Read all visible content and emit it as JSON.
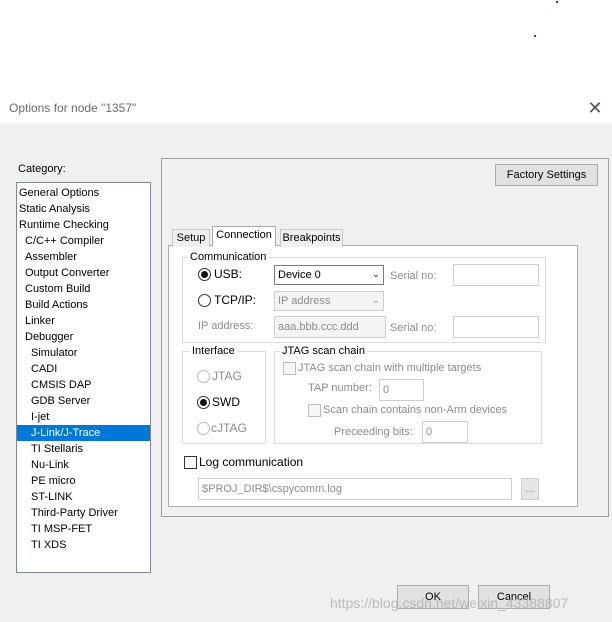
{
  "dialog": {
    "title": "Options for node \"1357\"",
    "close_glyph": "✕"
  },
  "category": {
    "label": "Category:",
    "items": [
      {
        "label": "General Options",
        "indent": 0
      },
      {
        "label": "Static Analysis",
        "indent": 0
      },
      {
        "label": "Runtime Checking",
        "indent": 0
      },
      {
        "label": "C/C++ Compiler",
        "indent": 1
      },
      {
        "label": "Assembler",
        "indent": 1
      },
      {
        "label": "Output Converter",
        "indent": 1
      },
      {
        "label": "Custom Build",
        "indent": 1
      },
      {
        "label": "Build Actions",
        "indent": 1
      },
      {
        "label": "Linker",
        "indent": 1
      },
      {
        "label": "Debugger",
        "indent": 1
      },
      {
        "label": "Simulator",
        "indent": 2
      },
      {
        "label": "CADI",
        "indent": 2
      },
      {
        "label": "CMSIS DAP",
        "indent": 2
      },
      {
        "label": "GDB Server",
        "indent": 2
      },
      {
        "label": "I-jet",
        "indent": 2
      },
      {
        "label": "J-Link/J-Trace",
        "indent": 2,
        "selected": true
      },
      {
        "label": "TI Stellaris",
        "indent": 2
      },
      {
        "label": "Nu-Link",
        "indent": 2
      },
      {
        "label": "PE micro",
        "indent": 2
      },
      {
        "label": "ST-LINK",
        "indent": 2
      },
      {
        "label": "Third-Party Driver",
        "indent": 2
      },
      {
        "label": "TI MSP-FET",
        "indent": 2
      },
      {
        "label": "TI XDS",
        "indent": 2
      }
    ]
  },
  "factory_settings": "Factory Settings",
  "tabs": [
    {
      "label": "Setup",
      "active": false
    },
    {
      "label": "Connection",
      "active": true
    },
    {
      "label": "Breakpoints",
      "active": false
    }
  ],
  "communication": {
    "title": "Communication",
    "usb_label": "USB:",
    "usb_selected": true,
    "usb_device": "Device 0",
    "serial_label": "Serial no:",
    "serial_value": "",
    "tcpip_label": "TCP/IP:",
    "tcpip_selected": false,
    "tcpip_mode": "IP address",
    "ip_label": "IP address:",
    "ip_value": "aaa.bbb.ccc.ddd",
    "serial2_label": "Serial no:",
    "serial2_value": ""
  },
  "interface": {
    "title": "Interface",
    "options": [
      {
        "label": "JTAG",
        "selected": false,
        "enabled": false
      },
      {
        "label": "SWD",
        "selected": true,
        "enabled": true
      },
      {
        "label": "cJTAG",
        "selected": false,
        "enabled": false
      }
    ]
  },
  "jtag_chain": {
    "title": "JTAG scan chain",
    "multi_label": "JTAG scan chain with multiple targets",
    "tap_label": "TAP number:",
    "tap_value": "0",
    "nonarm_label": "Scan chain contains non-Arm devices",
    "preceeding_label": "Preceeding bits:",
    "preceeding_value": "0"
  },
  "log": {
    "label": "Log communication",
    "checked": false,
    "path": "$PROJ_DIR$\\cspycomm.log",
    "browse": "..."
  },
  "buttons": {
    "ok": "OK",
    "cancel": "Cancel"
  },
  "watermark": "https://blog.csdn.net/weixin_43388807"
}
